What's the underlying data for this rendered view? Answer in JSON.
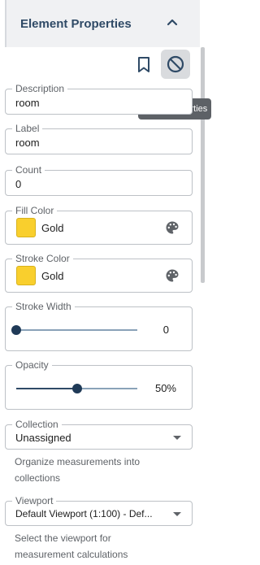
{
  "header": {
    "title": "Element Properties"
  },
  "tooltip": {
    "text": "Clear properties"
  },
  "fields": {
    "description": {
      "label": "Description",
      "value": "room"
    },
    "label": {
      "label": "Label",
      "value": "room"
    },
    "count": {
      "label": "Count",
      "value": "0"
    },
    "fill_color": {
      "label": "Fill Color",
      "value": "Gold",
      "swatch": "#F9CF2D"
    },
    "stroke_color": {
      "label": "Stroke Color",
      "value": "Gold",
      "swatch": "#F9CF2D"
    },
    "stroke_width": {
      "label": "Stroke Width",
      "value_text": "0",
      "level": 0
    },
    "opacity": {
      "label": "Opacity",
      "value_text": "50%",
      "level": 0.5
    },
    "collection": {
      "label": "Collection",
      "value": "Unassigned",
      "helper": "Organize measurements into collections"
    },
    "viewport": {
      "label": "Viewport",
      "value": "Default Viewport (1:100) - Def...",
      "helper": "Select the viewport for measurement calculations"
    }
  },
  "icons": {
    "collapse": "chevron-up-icon",
    "bookmark": "bookmark-icon",
    "clear": "block-icon",
    "palette": "palette-icon",
    "dropdown": "caret-down-icon"
  },
  "colors": {
    "accent": "#2F4A66",
    "header_bg": "#F0F1F3",
    "gold": "#F9CF2D"
  }
}
